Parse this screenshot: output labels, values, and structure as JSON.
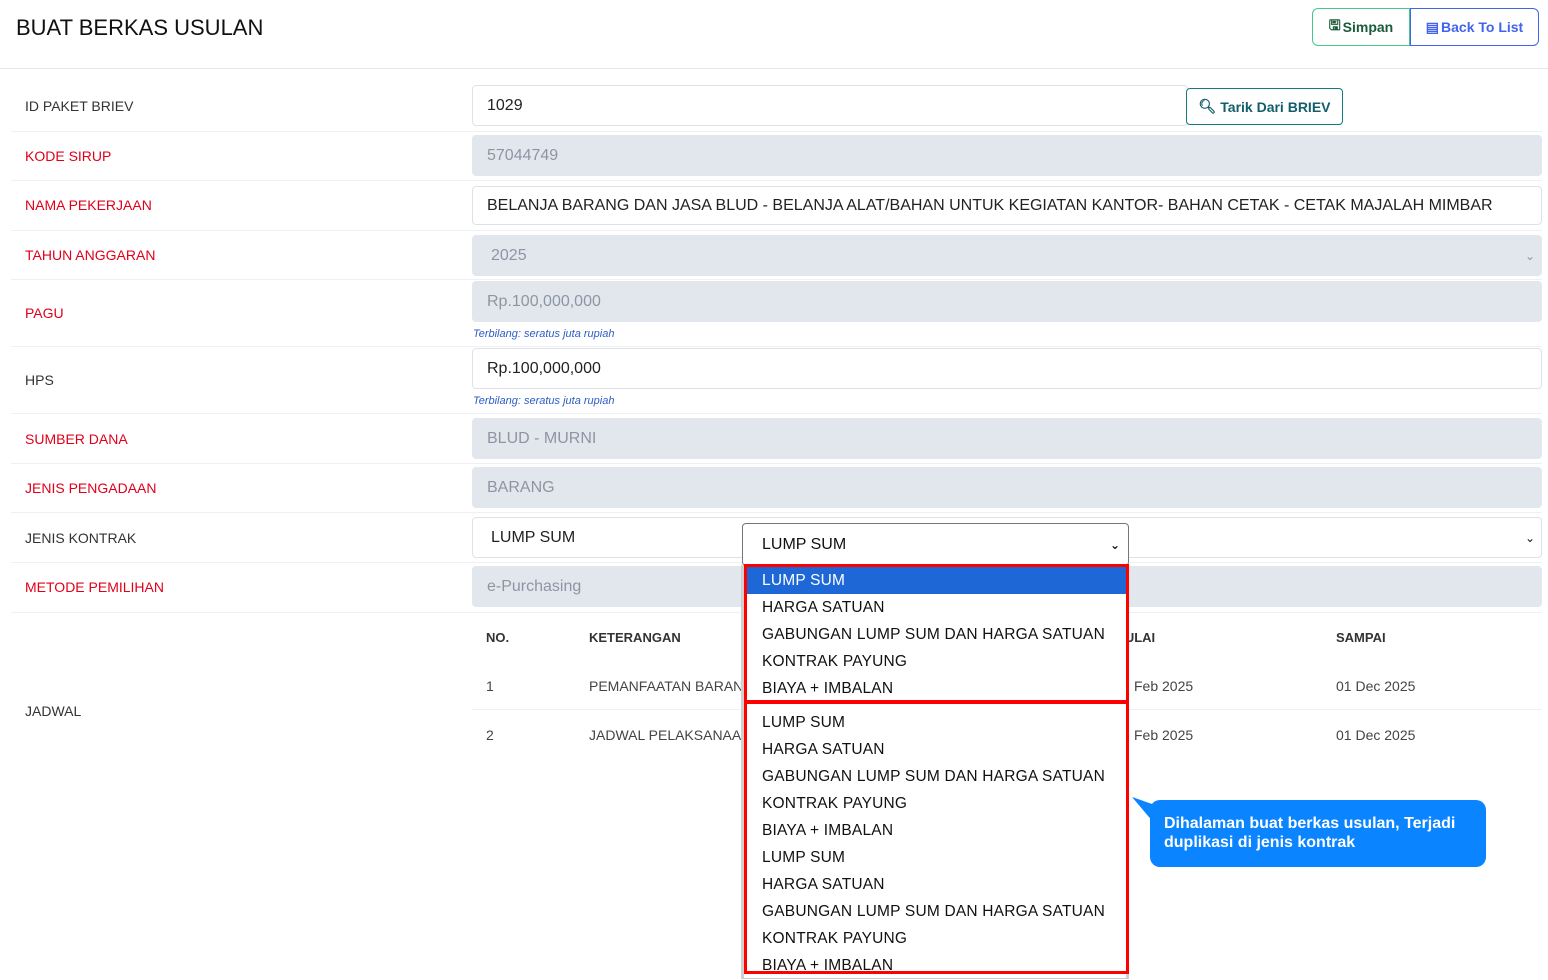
{
  "header": {
    "title": "BUAT BERKAS USULAN",
    "simpan": "Simpan",
    "back": "Back To List"
  },
  "form": {
    "id_paket": {
      "label": "ID PAKET BRIEV",
      "value": "1029",
      "button": "Tarik Dari BRIEV"
    },
    "kode_sirup": {
      "label": "KODE SIRUP",
      "value": "57044749"
    },
    "nama_pekerjaan": {
      "label": "NAMA PEKERJAAN",
      "value": "BELANJA BARANG DAN JASA BLUD - BELANJA ALAT/BAHAN UNTUK KEGIATAN KANTOR- BAHAN CETAK - CETAK MAJALAH MIMBAR"
    },
    "tahun": {
      "label": "TAHUN ANGGARAN",
      "value": "2025"
    },
    "pagu": {
      "label": "PAGU",
      "value": "Rp.100,000,000",
      "hint": "Terbilang: seratus juta rupiah"
    },
    "hps": {
      "label": "HPS",
      "value": "Rp.100,000,000",
      "hint": "Terbilang: seratus juta rupiah"
    },
    "sumber_dana": {
      "label": "SUMBER DANA",
      "value": "BLUD - MURNI"
    },
    "jenis_pengadaan": {
      "label": "JENIS PENGADAAN",
      "value": "BARANG"
    },
    "jenis_kontrak": {
      "label": "JENIS KONTRAK",
      "value": "LUMP SUM"
    },
    "metode": {
      "label": "METODE PEMILIHAN",
      "value": "e-Purchasing"
    }
  },
  "jadwal": {
    "label": "JADWAL",
    "headers": [
      "NO.",
      "KETERANGAN",
      "MULAI",
      "SAMPAI"
    ],
    "rows": [
      [
        "1",
        "PEMANFAATAN BARAN",
        "Feb 2025",
        "01 Dec 2025"
      ],
      [
        "2",
        "JADWAL PELAKSANAA",
        "Feb 2025",
        "01 Dec 2025"
      ]
    ]
  },
  "dropdown": {
    "selected": "LUMP SUM",
    "options": [
      "LUMP SUM",
      "HARGA SATUAN",
      "GABUNGAN LUMP SUM DAN HARGA SATUAN",
      "KONTRAK PAYUNG",
      "BIAYA + IMBALAN",
      "LUMP SUM",
      "HARGA SATUAN",
      "GABUNGAN LUMP SUM DAN HARGA SATUAN",
      "KONTRAK PAYUNG",
      "BIAYA + IMBALAN",
      "LUMP SUM",
      "HARGA SATUAN",
      "GABUNGAN LUMP SUM DAN HARGA SATUAN",
      "KONTRAK PAYUNG",
      "BIAYA + IMBALAN"
    ]
  },
  "annotation": "Dihalaman buat berkas usulan, Terjadi duplikasi di jenis kontrak"
}
